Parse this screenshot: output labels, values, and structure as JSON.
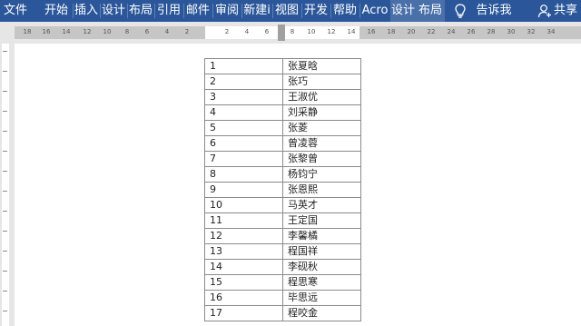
{
  "ribbon": {
    "tabs": [
      {
        "label": "文件"
      },
      {
        "label": "开始"
      },
      {
        "label": "插入"
      },
      {
        "label": "设计"
      },
      {
        "label": "布局"
      },
      {
        "label": "引用"
      },
      {
        "label": "邮件"
      },
      {
        "label": "审阅"
      },
      {
        "label": "新建i"
      },
      {
        "label": "视图"
      },
      {
        "label": "开发"
      },
      {
        "label": "帮助"
      },
      {
        "label": "Acro"
      },
      {
        "label": "设计"
      },
      {
        "label": "布局"
      }
    ],
    "tell_me": "告诉我",
    "share": "共享",
    "tell_me_icon": "lightbulb-icon",
    "share_icon": "person-icon"
  },
  "ruler": {
    "labels": [
      "18",
      "16",
      "14",
      "12",
      "10",
      "8",
      "6",
      "4",
      "2",
      "2",
      "4",
      "6",
      "8",
      "10",
      "12",
      "14",
      "16",
      "18",
      "20",
      "22",
      "24",
      "26",
      "28",
      "30",
      "32",
      "34"
    ]
  },
  "table": {
    "rows": [
      {
        "num": "1",
        "name": "张夏晗"
      },
      {
        "num": "2",
        "name": "张巧"
      },
      {
        "num": "3",
        "name": "王淑优"
      },
      {
        "num": "4",
        "name": "刘采静"
      },
      {
        "num": "5",
        "name": "张菱"
      },
      {
        "num": "6",
        "name": "曾凌蓉"
      },
      {
        "num": "7",
        "name": "张黎曾"
      },
      {
        "num": "8",
        "name": "杨钧宁"
      },
      {
        "num": "9",
        "name": "张恩熙"
      },
      {
        "num": "10",
        "name": "马英才"
      },
      {
        "num": "11",
        "name": "王定国"
      },
      {
        "num": "12",
        "name": "李馨橘"
      },
      {
        "num": "13",
        "name": "程国祥"
      },
      {
        "num": "14",
        "name": "李砚秋"
      },
      {
        "num": "15",
        "name": "程思寒"
      },
      {
        "num": "16",
        "name": "毕思远"
      },
      {
        "num": "17",
        "name": "程咬金"
      }
    ]
  }
}
